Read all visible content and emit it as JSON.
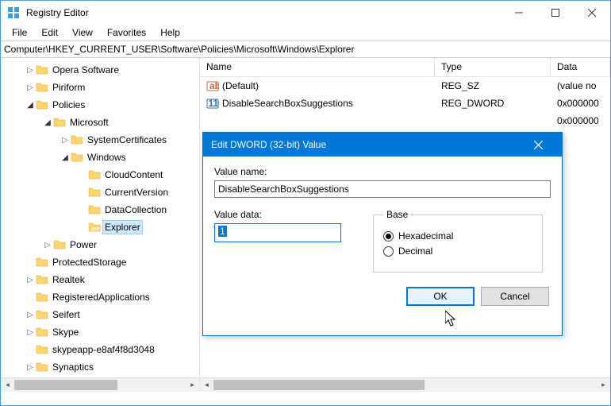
{
  "window": {
    "title": "Registry Editor"
  },
  "menu": {
    "file": "File",
    "edit": "Edit",
    "view": "View",
    "favorites": "Favorites",
    "help": "Help"
  },
  "address": "Computer\\HKEY_CURRENT_USER\\Software\\Policies\\Microsoft\\Windows\\Explorer",
  "tree": {
    "n0": "Opera Software",
    "n1": "Piriform",
    "n2": "Policies",
    "n3": "Microsoft",
    "n4": "SystemCertificates",
    "n5": "Windows",
    "n6": "CloudContent",
    "n7": "CurrentVersion",
    "n8": "DataCollection",
    "n9": "Explorer",
    "n10": "Power",
    "n11": "ProtectedStorage",
    "n12": "Realtek",
    "n13": "RegisteredApplications",
    "n14": "Seifert",
    "n15": "Skype",
    "n16": "skypeapp-e8af4f8d3048",
    "n17": "Synaptics"
  },
  "list": {
    "headers": {
      "name": "Name",
      "type": "Type",
      "data": "Data"
    },
    "rows": [
      {
        "name": "(Default)",
        "type": "REG_SZ",
        "data": "(value no",
        "icon": "string"
      },
      {
        "name": "DisableSearchBoxSuggestions",
        "type": "REG_DWORD",
        "data": "0x000000",
        "icon": "binary"
      },
      {
        "name": "",
        "type": "",
        "data": "0x000000",
        "icon": ""
      }
    ]
  },
  "dialog": {
    "title": "Edit DWORD (32-bit) Value",
    "valueNameLabel": "Value name:",
    "valueName": "DisableSearchBoxSuggestions",
    "valueDataLabel": "Value data:",
    "valueData": "1",
    "baseLabel": "Base",
    "hexLabel": "Hexadecimal",
    "decLabel": "Decimal",
    "ok": "OK",
    "cancel": "Cancel"
  }
}
